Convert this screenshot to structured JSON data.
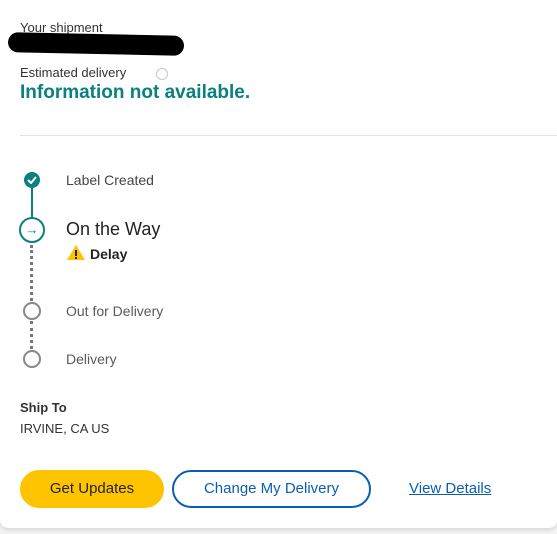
{
  "shipment": {
    "heading": "Your shipment",
    "estimated_delivery_label": "Estimated delivery",
    "estimated_delivery_value": "Information not available."
  },
  "timeline": {
    "steps": [
      {
        "label": "Label Created",
        "status": "done",
        "icon": "check-icon"
      },
      {
        "label": "On the Way",
        "status": "current",
        "icon": "arrow-right-icon"
      },
      {
        "label": "Out for Delivery",
        "status": "pending",
        "icon": "empty-circle-icon"
      },
      {
        "label": "Delivery",
        "status": "pending",
        "icon": "empty-circle-icon"
      }
    ],
    "current_alert": {
      "label": "Delay",
      "icon": "warning-icon"
    }
  },
  "ship_to": {
    "label": "Ship To",
    "value": "IRVINE, CA US"
  },
  "actions": {
    "get_updates": "Get Updates",
    "change_delivery": "Change My Delivery",
    "view_details": "View Details"
  },
  "colors": {
    "accent_teal": "#0a8080",
    "primary_blue": "#0a5eb0",
    "cta_yellow": "#ffc400",
    "warning_yellow": "#ffc400"
  }
}
